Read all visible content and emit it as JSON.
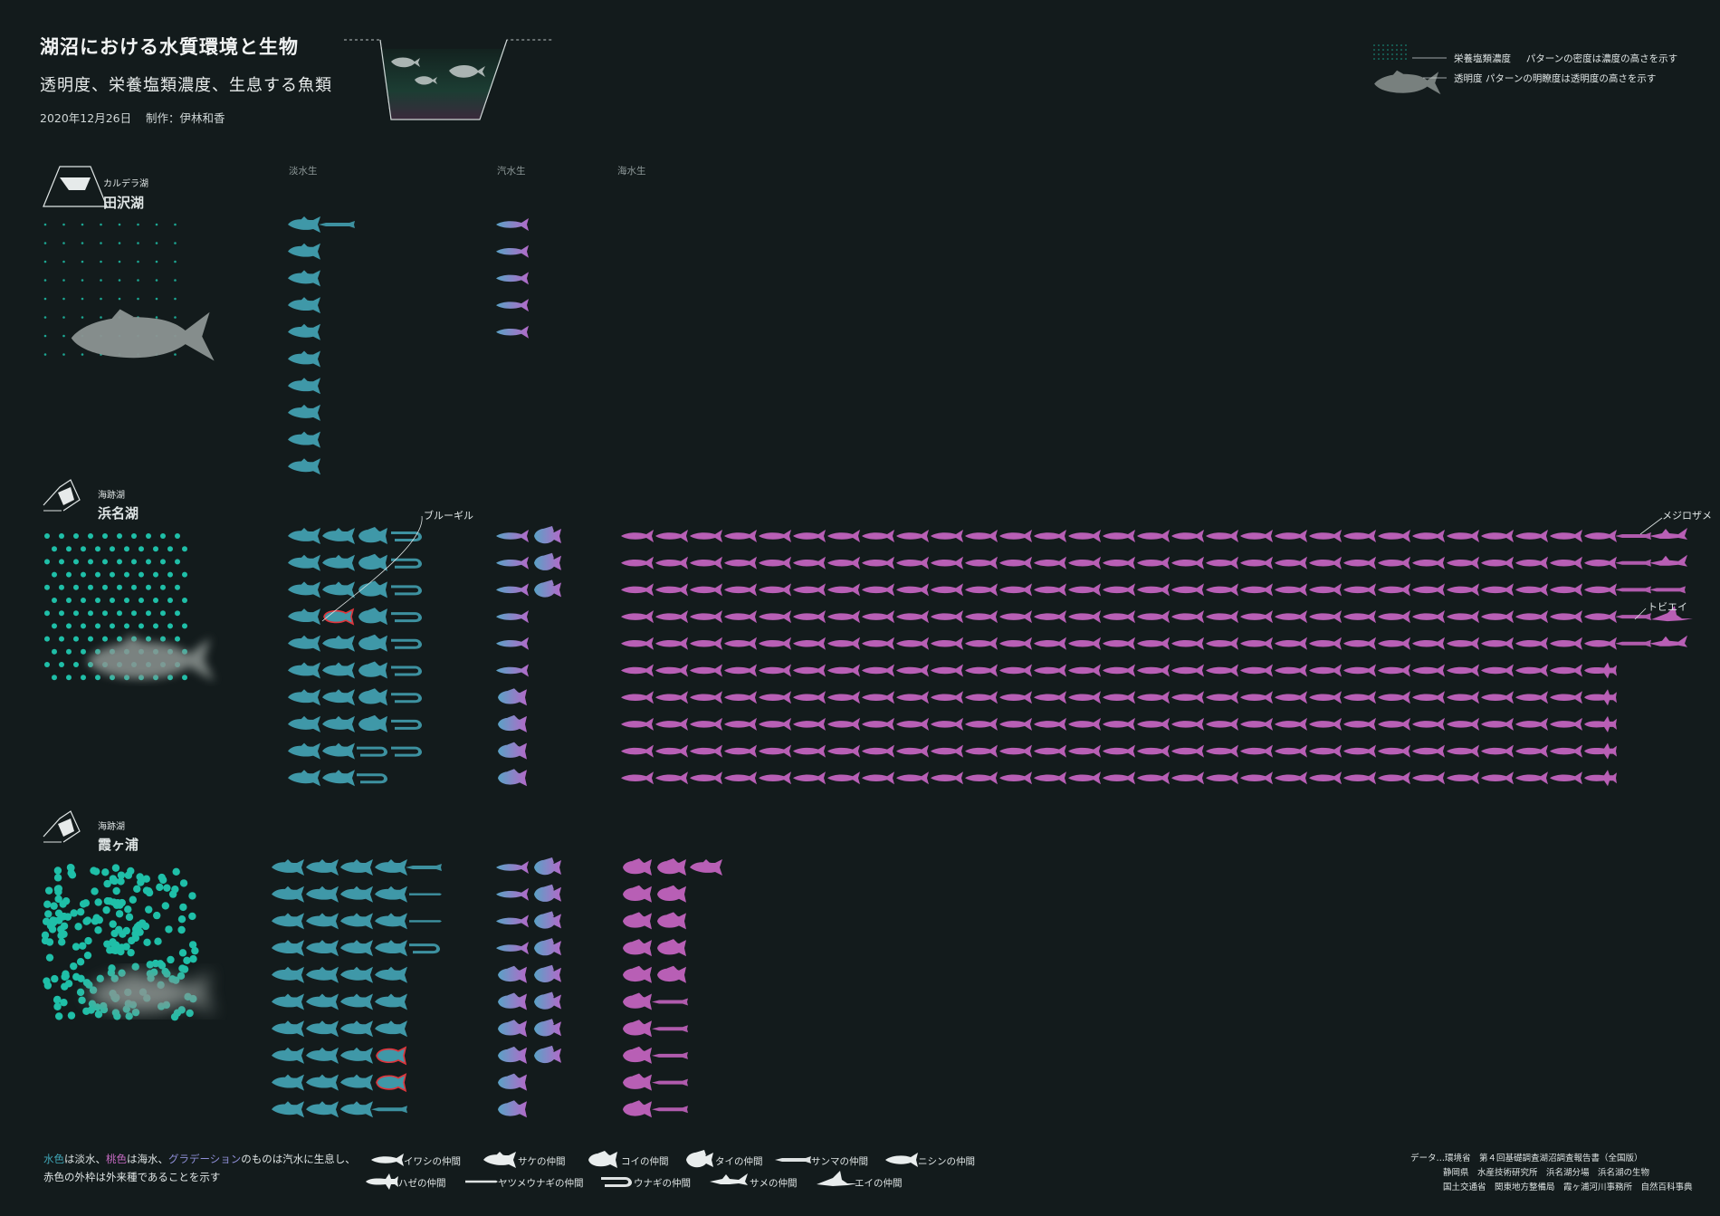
{
  "header": {
    "title": "湖沼における水質環境と生物",
    "subtitle": "透明度、栄養塩類濃度、生息する魚類",
    "date": "2020年12月26日",
    "credit": "制作：伊林和香"
  },
  "pattern_legend": {
    "nutrient": "栄養塩類濃度",
    "nutrient_desc": "パターンの密度は濃度の高さを示す",
    "clarity": "透明度",
    "clarity_desc": "パターンの明瞭度は透明度の高さを示す"
  },
  "columns": [
    "淡水生",
    "汽水生",
    "海水生"
  ],
  "colors": {
    "freshwater": "#3f98a8",
    "saltwater": "#b85fb5",
    "brackish_start": "#5da3c7",
    "brackish_end": "#b06ac4",
    "alien_outline": "#e0353c",
    "dot": "#1fbfa8"
  },
  "chart_data": {
    "type": "pictogram",
    "note": "Each icon is one fish species, grouped by lake and habitat",
    "lakes": [
      {
        "type": "カルデラ湖",
        "name": "田沢湖",
        "nutrient_level": 1,
        "clarity_level": 3,
        "freshwater": [
          [
            "salmon",
            "sanma"
          ],
          [
            "salmon"
          ],
          [
            "salmon"
          ],
          [
            "salmon"
          ],
          [
            "salmon"
          ],
          [
            "salmon"
          ],
          [
            "salmon"
          ],
          [
            "salmon"
          ],
          [
            "salmon"
          ],
          [
            "salmon"
          ]
        ],
        "brackish": [
          [
            "sardine"
          ],
          [
            "sardine"
          ],
          [
            "sardine"
          ],
          [
            "sardine"
          ],
          [
            "sardine"
          ]
        ],
        "saltwater": []
      },
      {
        "type": "海跡湖",
        "name": "浜名湖",
        "nutrient_level": 2,
        "clarity_level": 2,
        "freshwater": [
          [
            "salmon",
            "salmon",
            "carp",
            "eel"
          ],
          [
            "salmon",
            "salmon",
            "carp",
            "eel"
          ],
          [
            "salmon",
            "salmon",
            "carp",
            "eel"
          ],
          [
            "salmon",
            "alien_bluegill",
            "carp",
            "eel"
          ],
          [
            "salmon",
            "salmon",
            "carp",
            "eel"
          ],
          [
            "salmon",
            "salmon",
            "carp",
            "eel"
          ],
          [
            "salmon",
            "salmon",
            "carp",
            "eel"
          ],
          [
            "salmon",
            "salmon",
            "carp",
            "eel"
          ],
          [
            "salmon",
            "salmon",
            "eel",
            "eel"
          ],
          [
            "salmon",
            "salmon",
            "eel"
          ]
        ],
        "brackish": [
          [
            "sardine",
            "sea_bream"
          ],
          [
            "sardine",
            "sea_bream"
          ],
          [
            "sardine",
            "sea_bream"
          ],
          [
            "sardine"
          ],
          [
            "sardine"
          ],
          [
            "sardine"
          ],
          [
            "carp"
          ],
          [
            "carp"
          ],
          [
            "carp"
          ],
          [
            "carp"
          ]
        ],
        "saltwater_rows": [
          {
            "count": 29,
            "tail": [
              "sanma",
              "shark"
            ]
          },
          {
            "count": 29,
            "tail": [
              "sanma",
              "shark"
            ]
          },
          {
            "count": 29,
            "tail": [
              "sanma",
              "sanma"
            ]
          },
          {
            "count": 29,
            "tail": [
              "sanma",
              "ray"
            ]
          },
          {
            "count": 29,
            "tail": [
              "sanma",
              "shark"
            ]
          },
          {
            "count": 28,
            "tail": [
              "goby"
            ]
          },
          {
            "count": 28,
            "tail": [
              "goby"
            ]
          },
          {
            "count": 28,
            "tail": [
              "goby"
            ]
          },
          {
            "count": 28,
            "tail": [
              "goby"
            ]
          },
          {
            "count": 28,
            "tail": [
              "goby"
            ]
          }
        ],
        "annotations": [
          "ブルーギル",
          "メジロザメ",
          "トビエイ"
        ]
      },
      {
        "type": "海跡湖",
        "name": "霞ヶ浦",
        "nutrient_level": 3,
        "clarity_level": 1,
        "freshwater": [
          [
            "salmon",
            "salmon",
            "salmon",
            "salmon",
            "sanma"
          ],
          [
            "salmon",
            "salmon",
            "salmon",
            "salmon",
            "lamprey"
          ],
          [
            "salmon",
            "salmon",
            "salmon",
            "salmon",
            "lamprey"
          ],
          [
            "salmon",
            "salmon",
            "salmon",
            "salmon",
            "eel"
          ],
          [
            "salmon",
            "salmon",
            "salmon",
            "salmon"
          ],
          [
            "salmon",
            "salmon",
            "salmon",
            "salmon"
          ],
          [
            "salmon",
            "salmon",
            "salmon",
            "salmon"
          ],
          [
            "salmon",
            "salmon",
            "salmon",
            "alien"
          ],
          [
            "salmon",
            "salmon",
            "salmon",
            "alien"
          ],
          [
            "salmon",
            "salmon",
            "salmon",
            "sanma"
          ]
        ],
        "brackish": [
          [
            "sardine",
            "sea_bream"
          ],
          [
            "sardine",
            "sea_bream"
          ],
          [
            "sardine",
            "sea_bream"
          ],
          [
            "sardine",
            "sea_bream"
          ],
          [
            "carp",
            "sea_bream"
          ],
          [
            "carp",
            "sea_bream"
          ],
          [
            "carp",
            "sea_bream"
          ],
          [
            "carp",
            "sea_bream"
          ],
          [
            "carp"
          ],
          [
            "carp"
          ]
        ],
        "saltwater": [
          [
            "carp",
            "carp",
            "salmon"
          ],
          [
            "carp",
            "carp"
          ],
          [
            "carp",
            "carp"
          ],
          [
            "carp",
            "carp"
          ],
          [
            "carp",
            "carp"
          ],
          [
            "carp",
            "sanma"
          ],
          [
            "carp",
            "sanma"
          ],
          [
            "carp",
            "sanma"
          ],
          [
            "carp",
            "sanma"
          ],
          [
            "carp",
            "sanma"
          ]
        ]
      }
    ]
  },
  "fish_legend": [
    {
      "icon": "sardine",
      "label": "イワシの仲間"
    },
    {
      "icon": "salmon",
      "label": "サケの仲間"
    },
    {
      "icon": "carp",
      "label": "コイの仲間"
    },
    {
      "icon": "sea_bream",
      "label": "タイの仲間"
    },
    {
      "icon": "sanma",
      "label": "サンマの仲間"
    },
    {
      "icon": "herring",
      "label": "ニシンの仲間"
    },
    {
      "icon": "goby",
      "label": "ハゼの仲間"
    },
    {
      "icon": "lamprey",
      "label": "ヤツメウナギの仲間"
    },
    {
      "icon": "eel",
      "label": "ウナギの仲間"
    },
    {
      "icon": "shark",
      "label": "サメの仲間"
    },
    {
      "icon": "ray",
      "label": "エイの仲間"
    }
  ],
  "footer": {
    "note_fresh": "水色",
    "note_1": "は淡水、",
    "note_sea": "桃色",
    "note_2": "は海水、",
    "note_grad": "グラデーション",
    "note_3": "のものは汽水に生息し、",
    "note_line2": "赤色の外枠は外来種であることを示す",
    "source_lines": [
      "データ…環境省　第４回基礎調査湖沼調査報告書（全国版）",
      "静岡県　水産技術研究所　浜名湖分場　浜名湖の生物",
      "国土交通省　関東地方整備局　霞ヶ浦河川事務所　自然百科事典"
    ]
  }
}
